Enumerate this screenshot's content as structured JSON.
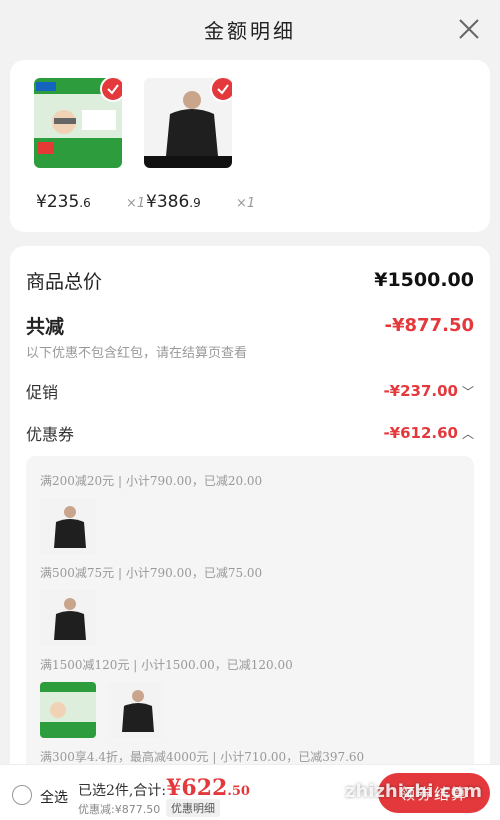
{
  "header": {
    "title": "金额明细"
  },
  "products": [
    {
      "price_main": "¥235",
      "price_dec": ".6",
      "qty": "×1"
    },
    {
      "price_main": "¥386",
      "price_dec": ".9",
      "qty": "×1"
    }
  ],
  "summary": {
    "total_label": "商品总价",
    "total_value": "¥1500.00",
    "discount_label": "共减",
    "discount_value": "-¥877.50",
    "note": "以下优惠不包含红包，请在结算页查看",
    "promo_label": "促销",
    "promo_value": "-¥237.00",
    "coupon_label": "优惠券",
    "coupon_value": "-¥612.60"
  },
  "coupons": [
    {
      "rule": "满200减20元 | 小计790.00，已减20.00"
    },
    {
      "rule": "满500减75元 | 小计790.00，已减75.00"
    },
    {
      "rule": "满1500减120元 | 小计1500.00，已减120.00"
    },
    {
      "rule": "满300享4.4折，最高减4000元 | 小计710.00，已减397.60"
    }
  ],
  "bottom": {
    "select_all": "全选",
    "selected_prefix": "已选2件,合计:",
    "amount_main": "¥622",
    "amount_dec": ".50",
    "saved": "优惠减:¥877.50",
    "detail_btn": "优惠明细",
    "checkout": "领券结算",
    "watermark": "zhizhizhi.com"
  },
  "colors": {
    "accent": "#e4393c",
    "background": "#f2f2f2"
  }
}
